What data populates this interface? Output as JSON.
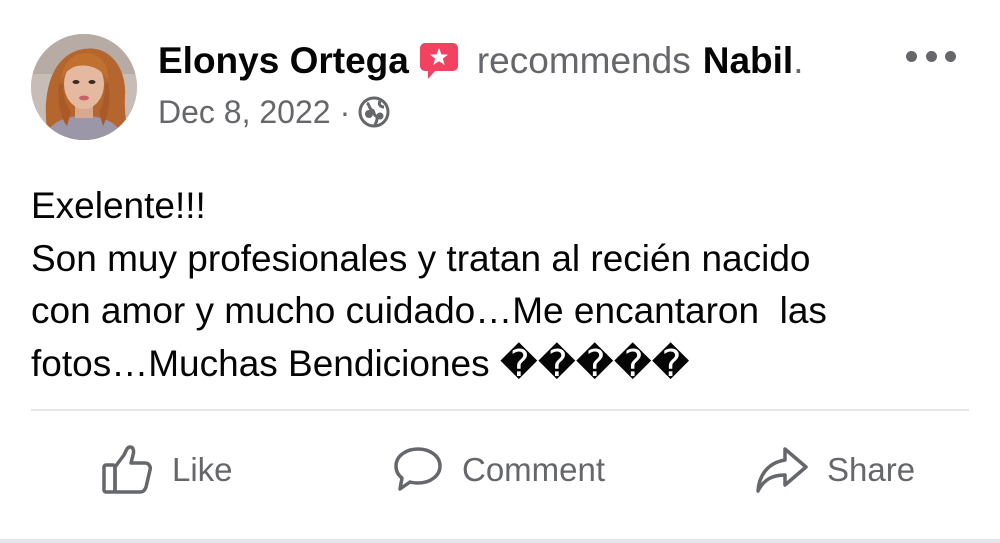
{
  "post": {
    "author_name": "Elonys Ortega",
    "recommends_text": "recommends",
    "page_name": "Nabil",
    "period": ".",
    "date": "Dec 8, 2022",
    "meta_separator": "·",
    "audience_icon": "globe-icon",
    "badge_icon": "recommendation-badge-icon",
    "text_lines": [
      "Exelente!!!",
      "Son muy profesionales y tratan al recién nacido",
      "con amor y mucho cuidado…Me encantaron  las",
      "fotos…Muchas Bendiciones �����"
    ]
  },
  "actions": {
    "like_label": "Like",
    "comment_label": "Comment",
    "share_label": "Share"
  },
  "colors": {
    "text_primary": "#050505",
    "text_secondary": "#65676b",
    "badge": "#f3425f",
    "divider": "#e4e6eb"
  }
}
